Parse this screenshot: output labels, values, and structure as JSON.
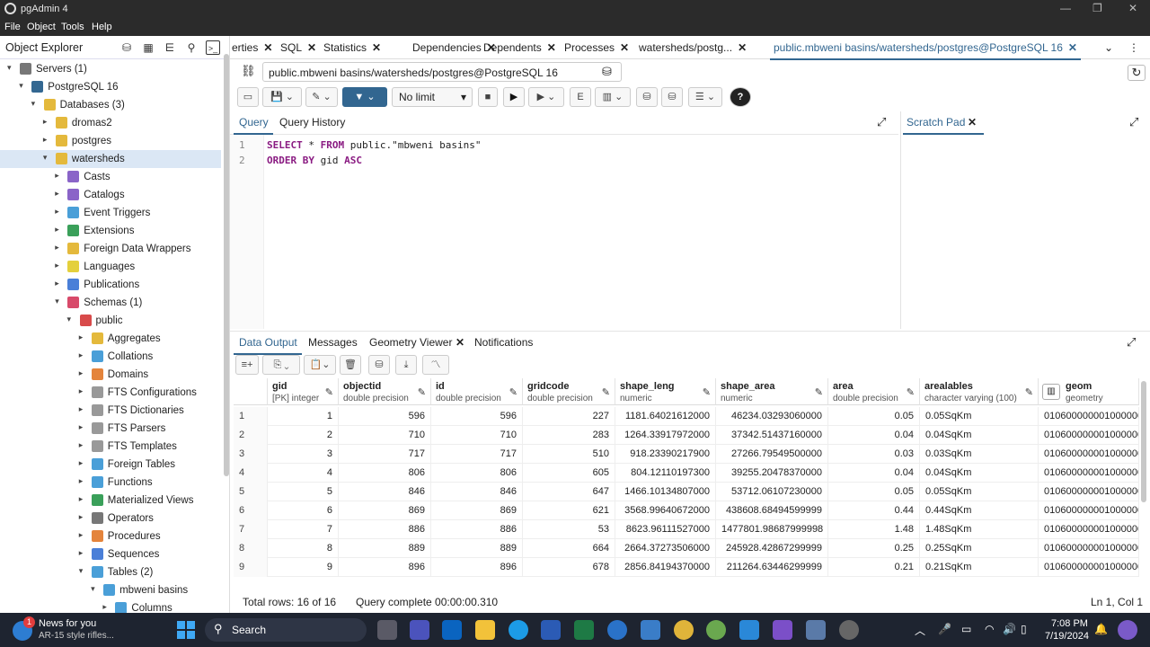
{
  "app": {
    "title": "pgAdmin 4",
    "menu": [
      "File",
      "Object",
      "Tools",
      "Help"
    ]
  },
  "explorer": {
    "title": "Object Explorer",
    "nodes": [
      {
        "label": "Servers (1)",
        "indent": 0,
        "arrow": "v",
        "icon": "#777"
      },
      {
        "label": "PostgreSQL 16",
        "indent": 1,
        "arrow": "v",
        "icon": "#336791"
      },
      {
        "label": "Databases (3)",
        "indent": 2,
        "arrow": "v",
        "icon": "#e4b93c"
      },
      {
        "label": "dromas2",
        "indent": 3,
        "arrow": ">",
        "icon": "#e4b93c"
      },
      {
        "label": "postgres",
        "indent": 3,
        "arrow": ">",
        "icon": "#e4b93c"
      },
      {
        "label": "watersheds",
        "indent": 3,
        "arrow": "v",
        "icon": "#e4b93c",
        "selected": true
      },
      {
        "label": "Casts",
        "indent": 4,
        "arrow": ">",
        "icon": "#8a64c8"
      },
      {
        "label": "Catalogs",
        "indent": 4,
        "arrow": ">",
        "icon": "#8a64c8"
      },
      {
        "label": "Event Triggers",
        "indent": 4,
        "arrow": ">",
        "icon": "#4a9fd8"
      },
      {
        "label": "Extensions",
        "indent": 4,
        "arrow": ">",
        "icon": "#3aa05a"
      },
      {
        "label": "Foreign Data Wrappers",
        "indent": 4,
        "arrow": ">",
        "icon": "#e4b93c"
      },
      {
        "label": "Languages",
        "indent": 4,
        "arrow": ">",
        "icon": "#e4d03c"
      },
      {
        "label": "Publications",
        "indent": 4,
        "arrow": ">",
        "icon": "#4a7fd8"
      },
      {
        "label": "Schemas (1)",
        "indent": 4,
        "arrow": "v",
        "icon": "#d84a6a"
      },
      {
        "label": "public",
        "indent": 5,
        "arrow": "v",
        "icon": "#d84a4a"
      },
      {
        "label": "Aggregates",
        "indent": 6,
        "arrow": ">",
        "icon": "#e4b93c"
      },
      {
        "label": "Collations",
        "indent": 6,
        "arrow": ">",
        "icon": "#4a9fd8"
      },
      {
        "label": "Domains",
        "indent": 6,
        "arrow": ">",
        "icon": "#e4843c"
      },
      {
        "label": "FTS Configurations",
        "indent": 6,
        "arrow": ">",
        "icon": "#999"
      },
      {
        "label": "FTS Dictionaries",
        "indent": 6,
        "arrow": ">",
        "icon": "#999"
      },
      {
        "label": "FTS Parsers",
        "indent": 6,
        "arrow": ">",
        "icon": "#999"
      },
      {
        "label": "FTS Templates",
        "indent": 6,
        "arrow": ">",
        "icon": "#999"
      },
      {
        "label": "Foreign Tables",
        "indent": 6,
        "arrow": ">",
        "icon": "#4a9fd8"
      },
      {
        "label": "Functions",
        "indent": 6,
        "arrow": ">",
        "icon": "#4a9fd8"
      },
      {
        "label": "Materialized Views",
        "indent": 6,
        "arrow": ">",
        "icon": "#3aa05a"
      },
      {
        "label": "Operators",
        "indent": 6,
        "arrow": ">",
        "icon": "#777"
      },
      {
        "label": "Procedures",
        "indent": 6,
        "arrow": ">",
        "icon": "#e4843c"
      },
      {
        "label": "Sequences",
        "indent": 6,
        "arrow": ">",
        "icon": "#4a7fd8"
      },
      {
        "label": "Tables (2)",
        "indent": 6,
        "arrow": "v",
        "icon": "#4a9fd8"
      },
      {
        "label": "mbweni basins",
        "indent": 7,
        "arrow": "v",
        "icon": "#4a9fd8"
      },
      {
        "label": "Columns",
        "indent": 8,
        "arrow": ">",
        "icon": "#4a9fd8"
      }
    ]
  },
  "tabs": [
    {
      "label": "erties",
      "close": true
    },
    {
      "label": "SQL",
      "close": true
    },
    {
      "label": "Statistics",
      "close": true
    },
    {
      "label": "Dependencies",
      "close": true
    },
    {
      "label": "Dependents",
      "close": true
    },
    {
      "label": "Processes",
      "close": true
    },
    {
      "label": "watersheds/postg...",
      "close": true
    },
    {
      "label": "public.mbweni basins/watersheds/postgres@PostgreSQL 16",
      "close": true,
      "active": true
    }
  ],
  "connection": "public.mbweni basins/watersheds/postgres@PostgreSQL 16",
  "limit": "No limit",
  "query_tabs": {
    "query": "Query",
    "history": "Query History"
  },
  "editor": {
    "lines": [
      {
        "n": "1",
        "parts": [
          [
            "SELECT",
            "kw"
          ],
          [
            " * ",
            ""
          ],
          [
            "FROM",
            "kw"
          ],
          [
            " public.\"mbweni basins\"",
            ""
          ]
        ]
      },
      {
        "n": "2",
        "parts": [
          [
            "ORDER BY",
            "kw"
          ],
          [
            " gid ",
            ""
          ],
          [
            "ASC",
            "kw"
          ]
        ]
      }
    ]
  },
  "scratch": "Scratch Pad",
  "output_tabs": {
    "data": "Data Output",
    "messages": "Messages",
    "geometry": "Geometry Viewer",
    "notifications": "Notifications"
  },
  "grid": {
    "columns": [
      {
        "name": "gid",
        "type": "[PK] integer"
      },
      {
        "name": "objectid",
        "type": "double precision"
      },
      {
        "name": "id",
        "type": "double precision"
      },
      {
        "name": "gridcode",
        "type": "double precision"
      },
      {
        "name": "shape_leng",
        "type": "numeric"
      },
      {
        "name": "shape_area",
        "type": "numeric"
      },
      {
        "name": "area",
        "type": "double precision"
      },
      {
        "name": "arealables",
        "type": "character varying (100)"
      },
      {
        "name": "geom",
        "type": "geometry"
      }
    ],
    "rows": [
      [
        "1",
        "1",
        "596",
        "596",
        "227",
        "1181.64021612000",
        "46234.03293060000",
        "0.05",
        "0.05SqKm",
        "0106000000010000000"
      ],
      [
        "2",
        "2",
        "710",
        "710",
        "283",
        "1264.33917972000",
        "37342.51437160000",
        "0.04",
        "0.04SqKm",
        "0106000000010000000"
      ],
      [
        "3",
        "3",
        "717",
        "717",
        "510",
        "918.23390217900",
        "27266.79549500000",
        "0.03",
        "0.03SqKm",
        "0106000000010000000"
      ],
      [
        "4",
        "4",
        "806",
        "806",
        "605",
        "804.12110197300",
        "39255.20478370000",
        "0.04",
        "0.04SqKm",
        "0106000000010000000"
      ],
      [
        "5",
        "5",
        "846",
        "846",
        "647",
        "1466.10134807000",
        "53712.06107230000",
        "0.05",
        "0.05SqKm",
        "0106000000010000000"
      ],
      [
        "6",
        "6",
        "869",
        "869",
        "621",
        "3568.99640672000",
        "438608.68494599999",
        "0.44",
        "0.44SqKm",
        "0106000000010000000"
      ],
      [
        "7",
        "7",
        "886",
        "886",
        "53",
        "8623.96111527000",
        "1477801.98687999998",
        "1.48",
        "1.48SqKm",
        "0106000000010000000"
      ],
      [
        "8",
        "8",
        "889",
        "889",
        "664",
        "2664.37273506000",
        "245928.42867299999",
        "0.25",
        "0.25SqKm",
        "0106000000010000000"
      ],
      [
        "9",
        "9",
        "896",
        "896",
        "678",
        "2856.84194370000",
        "211264.63446299999",
        "0.21",
        "0.21SqKm",
        "0106000000010000000"
      ]
    ]
  },
  "status": {
    "rows": "Total rows: 16 of 16",
    "query": "Query complete 00:00:00.310",
    "pos": "Ln 1, Col 1"
  },
  "taskbar": {
    "news_title": "News for you",
    "news_sub": "AR-15 style rifles...",
    "news_badge": "1",
    "search": "Search",
    "time": "7:08 PM",
    "date": "7/19/2024"
  }
}
